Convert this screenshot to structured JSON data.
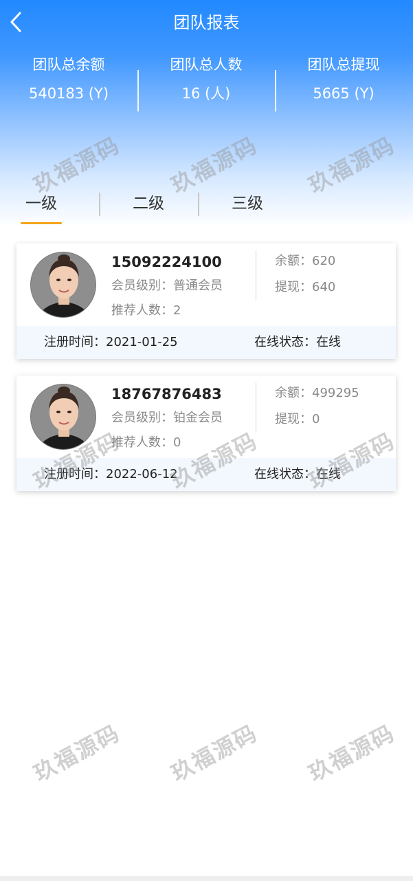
{
  "header": {
    "title": "团队报表",
    "back_icon": "chevron-left-icon"
  },
  "stats": [
    {
      "label": "团队总余额",
      "value": "540183 (Y)"
    },
    {
      "label": "团队总人数",
      "value": "16 (人)"
    },
    {
      "label": "团队总提现",
      "value": "5665 (Y)"
    }
  ],
  "tabs": [
    {
      "label": "一级",
      "active": true
    },
    {
      "label": "二级",
      "active": false
    },
    {
      "label": "三级",
      "active": false
    }
  ],
  "members": [
    {
      "phone": "15092224100",
      "level": "会员级别：普通会员",
      "referrals": "推荐人数：2",
      "balance": "余额：620",
      "withdraw": "提现：640",
      "register": "注册时间：2021-01-25",
      "online": "在线状态：在线"
    },
    {
      "phone": "18767876483",
      "level": "会员级别：铂金会员",
      "referrals": "推荐人数：0",
      "balance": "余额：499295",
      "withdraw": "提现：0",
      "register": "注册时间：2022-06-12",
      "online": "在线状态：在线"
    }
  ],
  "watermark": "玖福源码",
  "colors": {
    "primary": "#2289ff",
    "tab_underline": "#f3a51b",
    "card_footer": "#f3f8fe"
  }
}
